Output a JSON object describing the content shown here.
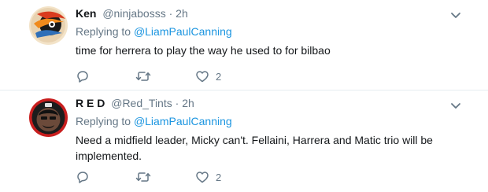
{
  "tweets": [
    {
      "name": "Ken",
      "handle": "@ninjabosss",
      "separator": "·",
      "time": "2h",
      "replying_prefix": "Replying to",
      "replying_to": "@LiamPaulCanning",
      "text": "time for herrera to play the way he used to for bilbao",
      "likes": "2"
    },
    {
      "name": "R E D",
      "handle": "@Red_Tints",
      "separator": "·",
      "time": "2h",
      "replying_prefix": "Replying to",
      "replying_to": "@LiamPaulCanning",
      "text": "Need a midfield leader, Micky can't. Fellaini, Harrera and Matic trio will be implemented.",
      "likes": "2"
    }
  ],
  "colors": {
    "text": "#14171a",
    "secondary": "#657786",
    "link": "#1b95e0",
    "divider": "#e6ecf0"
  },
  "icons": {
    "reply": "reply-icon",
    "retweet": "retweet-icon",
    "like": "heart-icon",
    "more": "chevron-down-icon"
  }
}
